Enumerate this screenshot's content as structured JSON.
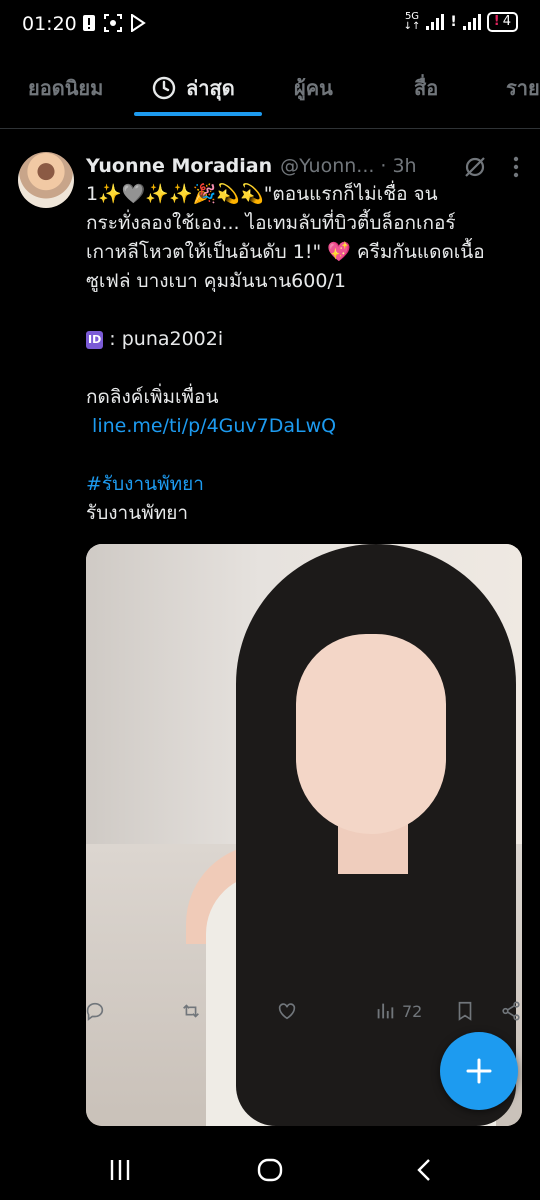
{
  "status_bar": {
    "time": "01:20",
    "network": "5G",
    "battery_level": "4"
  },
  "tabs": [
    {
      "label": "ยอดนิยม",
      "active": false
    },
    {
      "label": "ล่าสุด",
      "active": true,
      "icon": "clock-icon"
    },
    {
      "label": "ผู้คน",
      "active": false
    },
    {
      "label": "สื่อ",
      "active": false
    },
    {
      "label": "ราย",
      "active": false
    }
  ],
  "tweet": {
    "display_name": "Yuonne Moradian",
    "handle": "@Yuonn...",
    "separator": "·",
    "time": "3h",
    "body_lines": [
      "1✨🩶✨✨🎉💫💫\"ตอนแรกก็ไม่เชื่อ จน",
      "กระทั่งลองใช้เอง... ไอเทมลับที่บิวตี้บล็อกเกอร์",
      "เกาหลีโหวตให้เป็นอันดับ 1!\" 💖 ครีมกันแดดเนื้อ",
      "ซูเฟล่ บางเบา คุมมันนาน600/1"
    ],
    "id_badge": "ID",
    "id_text": ": puna2002i",
    "link_prompt": "กดลิงค์เพิ่มเพื่อน",
    "link": "line.me/ti/p/4Guv7DaLwQ",
    "hashtag": "#รับงานพัทยา",
    "tag_text": "รับงานพัทยา",
    "views": "72"
  },
  "colors": {
    "accent": "#1d9bf0",
    "background": "#000000",
    "text_primary": "#e7e9ea",
    "text_secondary": "#71767b"
  }
}
